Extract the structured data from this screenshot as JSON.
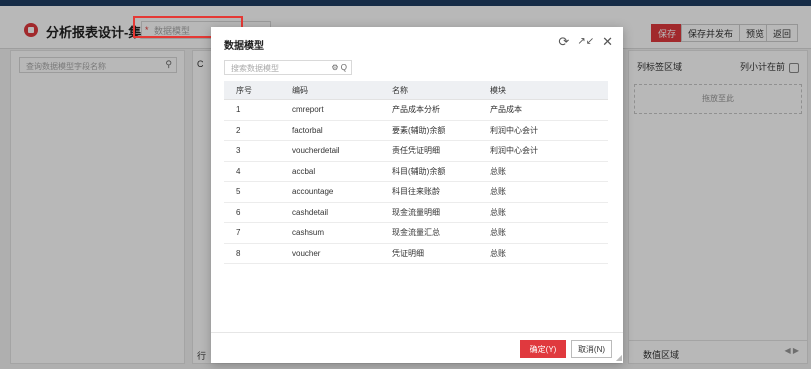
{
  "header": {
    "app_title": "分析报表设计-集团",
    "model_field_required": "*",
    "model_field_placeholder": "数据模型",
    "buttons": {
      "save": "保存",
      "save_publish": "保存并发布",
      "preview": "预览",
      "back": "返回"
    }
  },
  "left_panel": {
    "search_placeholder": "查询数据模型字段名称",
    "search_icon": "search-icon"
  },
  "center_panel": {
    "tab_char": "C",
    "row_char": "行"
  },
  "right_panel": {
    "column_tag_area": "列标签区域",
    "subtotal_label": "列小计在前",
    "drop_here": "拖放至此",
    "value_area": "数值区域",
    "arrows": "◀ ▶"
  },
  "modal": {
    "title": "数据模型",
    "tools": [
      "refresh-icon",
      "expand-icon",
      "close-icon"
    ],
    "search_placeholder": "搜索数据模型",
    "search_icons": "⚙ Q",
    "columns": [
      "序号",
      "编码",
      "名称",
      "模块"
    ],
    "rows": [
      {
        "no": "1",
        "code": "cmreport",
        "name": "产品成本分析",
        "module": "产品成本"
      },
      {
        "no": "2",
        "code": "factorbal",
        "name": "要素(辅助)余额",
        "module": "利润中心会计"
      },
      {
        "no": "3",
        "code": "voucherdetail",
        "name": "责任凭证明细",
        "module": "利润中心会计"
      },
      {
        "no": "4",
        "code": "accbal",
        "name": "科目(辅助)余额",
        "module": "总账"
      },
      {
        "no": "5",
        "code": "accountage",
        "name": "科目往来账龄",
        "module": "总账"
      },
      {
        "no": "6",
        "code": "cashdetail",
        "name": "现金流量明细",
        "module": "总账"
      },
      {
        "no": "7",
        "code": "cashsum",
        "name": "现金流量汇总",
        "module": "总账"
      },
      {
        "no": "8",
        "code": "voucher",
        "name": "凭证明细",
        "module": "总账"
      }
    ],
    "ok_label": "确定(Y)",
    "cancel_label": "取消(N)"
  },
  "colors": {
    "primary": "#e0393e",
    "topbar": "#1f3d63",
    "highlight": "#e53935"
  }
}
